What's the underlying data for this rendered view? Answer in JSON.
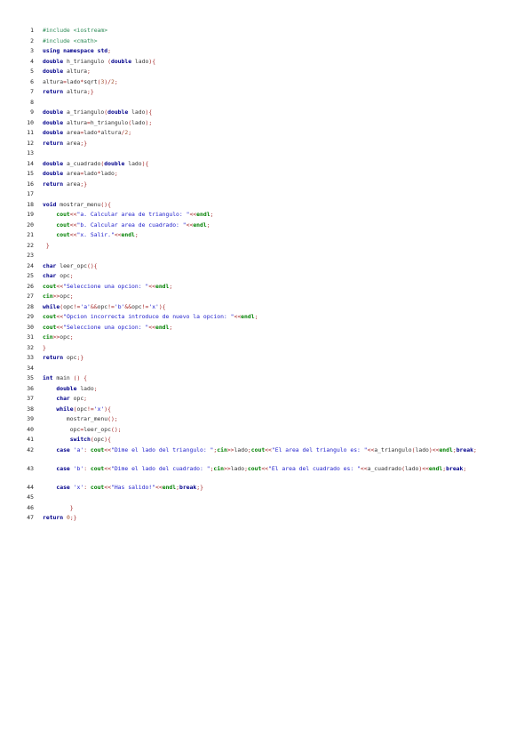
{
  "colors": {
    "keyword": "#00008b",
    "stream_keyword": "#008000",
    "preprocessor": "#2e8b57",
    "string": "#2222cc",
    "number": "#a0522d",
    "operator": "#a52a2a",
    "identifier": "#333333"
  },
  "lines": [
    {
      "n": "1",
      "tokens": [
        [
          "pp",
          "#include <iostream>"
        ]
      ]
    },
    {
      "n": "2",
      "tokens": [
        [
          "pp",
          "#include <cmath>"
        ]
      ]
    },
    {
      "n": "3",
      "tokens": [
        [
          "kw",
          "using"
        ],
        [
          "id",
          " "
        ],
        [
          "kw",
          "namespace"
        ],
        [
          "id",
          " "
        ],
        [
          "kw",
          "std"
        ],
        [
          "op",
          ";"
        ]
      ]
    },
    {
      "n": "4",
      "tokens": [
        [
          "kw",
          "double"
        ],
        [
          "id",
          " h_triangulo "
        ],
        [
          "op",
          "("
        ],
        [
          "kw",
          "double"
        ],
        [
          "id",
          " lado"
        ],
        [
          "op",
          ")"
        ],
        [
          "op",
          "{"
        ]
      ]
    },
    {
      "n": "5",
      "tokens": [
        [
          "kw",
          "double"
        ],
        [
          "id",
          " altura"
        ],
        [
          "op",
          ";"
        ]
      ]
    },
    {
      "n": "6",
      "tokens": [
        [
          "id",
          "altura"
        ],
        [
          "op",
          "="
        ],
        [
          "id",
          "lado"
        ],
        [
          "op",
          "*"
        ],
        [
          "id",
          "sqrt"
        ],
        [
          "op",
          "("
        ],
        [
          "num",
          "3"
        ],
        [
          "op",
          ")"
        ],
        [
          "op",
          "/"
        ],
        [
          "num",
          "2"
        ],
        [
          "op",
          ";"
        ]
      ]
    },
    {
      "n": "7",
      "tokens": [
        [
          "kw",
          "return"
        ],
        [
          "id",
          " altura"
        ],
        [
          "op",
          ";}"
        ]
      ]
    },
    {
      "n": "8",
      "tokens": []
    },
    {
      "n": "9",
      "tokens": [
        [
          "kw",
          "double"
        ],
        [
          "id",
          " a_triangulo"
        ],
        [
          "op",
          "("
        ],
        [
          "kw",
          "double"
        ],
        [
          "id",
          " lado"
        ],
        [
          "op",
          ")"
        ],
        [
          "op",
          "{"
        ]
      ]
    },
    {
      "n": "10",
      "tokens": [
        [
          "kw",
          "double"
        ],
        [
          "id",
          " altura"
        ],
        [
          "op",
          "="
        ],
        [
          "id",
          "h_triangulo"
        ],
        [
          "op",
          "("
        ],
        [
          "id",
          "lado"
        ],
        [
          "op",
          ");"
        ]
      ]
    },
    {
      "n": "11",
      "tokens": [
        [
          "kw",
          "double"
        ],
        [
          "id",
          " area"
        ],
        [
          "op",
          "="
        ],
        [
          "id",
          "lado"
        ],
        [
          "op",
          "*"
        ],
        [
          "id",
          "altura"
        ],
        [
          "op",
          "/"
        ],
        [
          "num",
          "2"
        ],
        [
          "op",
          ";"
        ]
      ]
    },
    {
      "n": "12",
      "tokens": [
        [
          "kw",
          "return"
        ],
        [
          "id",
          " area"
        ],
        [
          "op",
          ";}"
        ]
      ]
    },
    {
      "n": "13",
      "tokens": []
    },
    {
      "n": "14",
      "tokens": [
        [
          "kw",
          "double"
        ],
        [
          "id",
          " a_cuadrado"
        ],
        [
          "op",
          "("
        ],
        [
          "kw",
          "double"
        ],
        [
          "id",
          " lado"
        ],
        [
          "op",
          ")"
        ],
        [
          "op",
          "{"
        ]
      ]
    },
    {
      "n": "15",
      "tokens": [
        [
          "kw",
          "double"
        ],
        [
          "id",
          " area"
        ],
        [
          "op",
          "="
        ],
        [
          "id",
          "lado"
        ],
        [
          "op",
          "*"
        ],
        [
          "id",
          "lado"
        ],
        [
          "op",
          ";"
        ]
      ]
    },
    {
      "n": "16",
      "tokens": [
        [
          "kw",
          "return"
        ],
        [
          "id",
          " area"
        ],
        [
          "op",
          ";}"
        ]
      ]
    },
    {
      "n": "17",
      "tokens": []
    },
    {
      "n": "18",
      "tokens": [
        [
          "kw",
          "void"
        ],
        [
          "id",
          " mostrar_menu"
        ],
        [
          "op",
          "(){"
        ]
      ]
    },
    {
      "n": "19",
      "tokens": [
        [
          "id",
          "    "
        ],
        [
          "kw2",
          "cout"
        ],
        [
          "op",
          "<<"
        ],
        [
          "str",
          "\"a. Calcular area de triangulo: \""
        ],
        [
          "op",
          "<<"
        ],
        [
          "kw2",
          "endl"
        ],
        [
          "op",
          ";"
        ]
      ]
    },
    {
      "n": "20",
      "tokens": [
        [
          "id",
          "    "
        ],
        [
          "kw2",
          "cout"
        ],
        [
          "op",
          "<<"
        ],
        [
          "str",
          "\"b. Calcular area de cuadrado: \""
        ],
        [
          "op",
          "<<"
        ],
        [
          "kw2",
          "endl"
        ],
        [
          "op",
          ";"
        ]
      ]
    },
    {
      "n": "21",
      "tokens": [
        [
          "id",
          "    "
        ],
        [
          "kw2",
          "cout"
        ],
        [
          "op",
          "<<"
        ],
        [
          "str",
          "\"x. Salir.\""
        ],
        [
          "op",
          "<<"
        ],
        [
          "kw2",
          "endl"
        ],
        [
          "op",
          ";"
        ]
      ]
    },
    {
      "n": "22",
      "tokens": [
        [
          "op",
          " }"
        ]
      ]
    },
    {
      "n": "23",
      "tokens": []
    },
    {
      "n": "24",
      "tokens": [
        [
          "kw",
          "char"
        ],
        [
          "id",
          " leer_opc"
        ],
        [
          "op",
          "(){"
        ]
      ]
    },
    {
      "n": "25",
      "tokens": [
        [
          "kw",
          "char"
        ],
        [
          "id",
          " opc"
        ],
        [
          "op",
          ";"
        ]
      ]
    },
    {
      "n": "26",
      "tokens": [
        [
          "kw2",
          "cout"
        ],
        [
          "op",
          "<<"
        ],
        [
          "str",
          "\"Seleccione una opcion: \""
        ],
        [
          "op",
          "<<"
        ],
        [
          "kw2",
          "endl"
        ],
        [
          "op",
          ";"
        ]
      ]
    },
    {
      "n": "27",
      "tokens": [
        [
          "kw2",
          "cin"
        ],
        [
          "op",
          ">>"
        ],
        [
          "id",
          "opc"
        ],
        [
          "op",
          ";"
        ]
      ]
    },
    {
      "n": "28",
      "tokens": [
        [
          "kw",
          "while"
        ],
        [
          "op",
          "("
        ],
        [
          "id",
          "opc"
        ],
        [
          "op",
          "!="
        ],
        [
          "str",
          "'a'"
        ],
        [
          "op",
          "&&"
        ],
        [
          "id",
          "opc"
        ],
        [
          "op",
          "!="
        ],
        [
          "str",
          "'b'"
        ],
        [
          "op",
          "&&"
        ],
        [
          "id",
          "opc"
        ],
        [
          "op",
          "!="
        ],
        [
          "str",
          "'x'"
        ],
        [
          "op",
          "){"
        ]
      ]
    },
    {
      "n": "29",
      "tokens": [
        [
          "kw2",
          "cout"
        ],
        [
          "op",
          "<<"
        ],
        [
          "str",
          "\"Opcion incorrecta introduce de nuevo la opcion: \""
        ],
        [
          "op",
          "<<"
        ],
        [
          "kw2",
          "endl"
        ],
        [
          "op",
          ";"
        ]
      ]
    },
    {
      "n": "30",
      "tokens": [
        [
          "kw2",
          "cout"
        ],
        [
          "op",
          "<<"
        ],
        [
          "str",
          "\"Seleccione una opcion: \""
        ],
        [
          "op",
          "<<"
        ],
        [
          "kw2",
          "endl"
        ],
        [
          "op",
          ";"
        ]
      ]
    },
    {
      "n": "31",
      "tokens": [
        [
          "kw2",
          "cin"
        ],
        [
          "op",
          ">>"
        ],
        [
          "id",
          "opc"
        ],
        [
          "op",
          ";"
        ]
      ]
    },
    {
      "n": "32",
      "tokens": [
        [
          "op",
          "}"
        ]
      ]
    },
    {
      "n": "33",
      "tokens": [
        [
          "kw",
          "return"
        ],
        [
          "id",
          " opc"
        ],
        [
          "op",
          ";}"
        ]
      ]
    },
    {
      "n": "34",
      "tokens": []
    },
    {
      "n": "35",
      "tokens": [
        [
          "kw",
          "int"
        ],
        [
          "id",
          " main "
        ],
        [
          "op",
          "() {"
        ]
      ]
    },
    {
      "n": "36",
      "tokens": [
        [
          "id",
          "    "
        ],
        [
          "kw",
          "double"
        ],
        [
          "id",
          " lado"
        ],
        [
          "op",
          ";"
        ]
      ]
    },
    {
      "n": "37",
      "tokens": [
        [
          "id",
          "    "
        ],
        [
          "kw",
          "char"
        ],
        [
          "id",
          " opc"
        ],
        [
          "op",
          ";"
        ]
      ]
    },
    {
      "n": "38",
      "tokens": [
        [
          "id",
          "    "
        ],
        [
          "kw",
          "while"
        ],
        [
          "op",
          "("
        ],
        [
          "id",
          "opc"
        ],
        [
          "op",
          "!="
        ],
        [
          "str",
          "'x'"
        ],
        [
          "op",
          "){"
        ]
      ]
    },
    {
      "n": "39",
      "tokens": [
        [
          "id",
          "       mostrar_menu"
        ],
        [
          "op",
          "();"
        ]
      ]
    },
    {
      "n": "40",
      "tokens": [
        [
          "id",
          "        opc"
        ],
        [
          "op",
          "="
        ],
        [
          "id",
          "leer_opc"
        ],
        [
          "op",
          "();"
        ]
      ]
    },
    {
      "n": "41",
      "tokens": [
        [
          "id",
          "        "
        ],
        [
          "kw",
          "switch"
        ],
        [
          "op",
          "("
        ],
        [
          "id",
          "opc"
        ],
        [
          "op",
          "){"
        ]
      ]
    },
    {
      "n": "42",
      "tall": true,
      "tokens": [
        [
          "id",
          "    "
        ],
        [
          "kw",
          "case"
        ],
        [
          "id",
          " "
        ],
        [
          "str",
          "'a'"
        ],
        [
          "op",
          ": "
        ],
        [
          "kw2",
          "cout"
        ],
        [
          "op",
          "<<"
        ],
        [
          "str",
          "\"Dime el lado del triangulo: \""
        ],
        [
          "op",
          ";"
        ],
        [
          "kw2",
          "cin"
        ],
        [
          "op",
          ">>"
        ],
        [
          "id",
          "lado"
        ],
        [
          "op",
          ";"
        ],
        [
          "kw2",
          "cout"
        ],
        [
          "op",
          "<<"
        ],
        [
          "str",
          "\"El area del triangulo es: \""
        ],
        [
          "op",
          "<<"
        ],
        [
          "id",
          "a_triangulo"
        ],
        [
          "op",
          "("
        ],
        [
          "id",
          "lado"
        ],
        [
          "op",
          ")<<"
        ],
        [
          "kw2",
          "endl"
        ],
        [
          "op",
          ";"
        ],
        [
          "kw",
          "break"
        ],
        [
          "op",
          ";"
        ]
      ]
    },
    {
      "n": "43",
      "tall": true,
      "tokens": [
        [
          "id",
          "    "
        ],
        [
          "kw",
          "case"
        ],
        [
          "id",
          " "
        ],
        [
          "str",
          "'b'"
        ],
        [
          "op",
          ": "
        ],
        [
          "kw2",
          "cout"
        ],
        [
          "op",
          "<<"
        ],
        [
          "str",
          "\"Dime el lado del cuadrado: \""
        ],
        [
          "op",
          ";"
        ],
        [
          "kw2",
          "cin"
        ],
        [
          "op",
          ">>"
        ],
        [
          "id",
          "lado"
        ],
        [
          "op",
          ";"
        ],
        [
          "kw2",
          "cout"
        ],
        [
          "op",
          "<<"
        ],
        [
          "str",
          "\"El area del cuadrado es: \""
        ],
        [
          "op",
          "<<"
        ],
        [
          "id",
          "a_cuadrado"
        ],
        [
          "op",
          "("
        ],
        [
          "id",
          "lado"
        ],
        [
          "op",
          ")<<"
        ],
        [
          "kw2",
          "endl"
        ],
        [
          "op",
          ";"
        ],
        [
          "kw",
          "break"
        ],
        [
          "op",
          ";"
        ]
      ]
    },
    {
      "n": "44",
      "tokens": [
        [
          "id",
          "    "
        ],
        [
          "kw",
          "case"
        ],
        [
          "id",
          " "
        ],
        [
          "str",
          "'x'"
        ],
        [
          "op",
          ": "
        ],
        [
          "kw2",
          "cout"
        ],
        [
          "op",
          "<<"
        ],
        [
          "str",
          "\"Has salido!\""
        ],
        [
          "op",
          "<<"
        ],
        [
          "kw2",
          "endl"
        ],
        [
          "op",
          ";"
        ],
        [
          "kw",
          "break"
        ],
        [
          "op",
          ";}"
        ]
      ]
    },
    {
      "n": "45",
      "tokens": []
    },
    {
      "n": "46",
      "tokens": [
        [
          "op",
          "        }"
        ]
      ]
    },
    {
      "n": "47",
      "tokens": [
        [
          "kw",
          "return"
        ],
        [
          "id",
          " "
        ],
        [
          "num",
          "0"
        ],
        [
          "op",
          ";}"
        ]
      ]
    }
  ]
}
